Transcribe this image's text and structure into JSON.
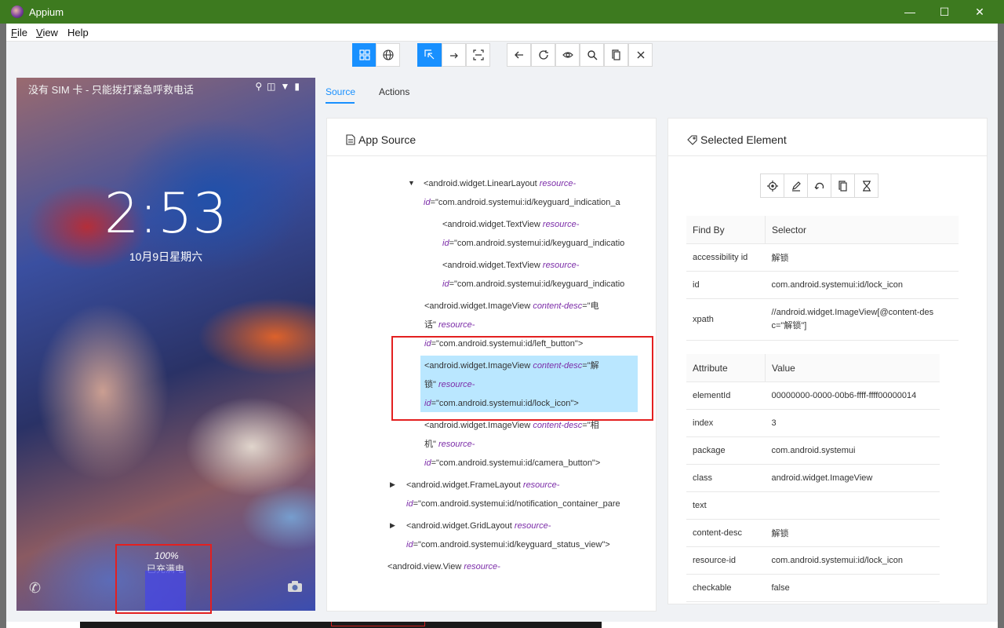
{
  "window": {
    "title": "Appium",
    "controls": [
      "—",
      "☐",
      "✕"
    ]
  },
  "menu": [
    {
      "label_u": "F",
      "label_rest": "ile"
    },
    {
      "label_u": "V",
      "label_rest": "iew"
    },
    {
      "label_u": "",
      "label_rest": "Help"
    }
  ],
  "device": {
    "status_text": "没有 SIM 卡 - 只能拨打紧急呼救电话",
    "clock": "2:53",
    "date": "10月9日星期六",
    "battery_percent": "100%",
    "charge_text": "已充满电"
  },
  "tabs": {
    "source": "Source",
    "actions": "Actions"
  },
  "app_source": {
    "title": "App Source",
    "nodes": [
      {
        "tag": "<android.widget.LinearLayout ",
        "attr": "resource-",
        "line2_attr": "id",
        "line2_val": "=\"com.android.systemui:id/keyguard_indication_a"
      },
      {
        "tag": "<android.widget.TextView ",
        "attr": "resource-",
        "line2_attr": "id",
        "line2_val": "=\"com.android.systemui:id/keyguard_indicatio"
      },
      {
        "tag": "<android.widget.TextView ",
        "attr": "resource-",
        "line2_attr": "id",
        "line2_val": "=\"com.android.systemui:id/keyguard_indicatio"
      },
      {
        "tag": "<android.widget.ImageView ",
        "attr": "content-desc",
        "val": "=\"电",
        "line2_val": "话\" ",
        "line2_attr": "resource-",
        "line3_attr": "id",
        "line3_val": "=\"com.android.systemui:id/left_button\">"
      },
      {
        "tag": "<android.widget.ImageView ",
        "attr": "content-desc",
        "val": "=\"解",
        "line2_val": "锁\" ",
        "line2_attr": "resource-",
        "line3_attr": "id",
        "line3_val": "=\"com.android.systemui:id/lock_icon\">"
      },
      {
        "tag": "<android.widget.ImageView ",
        "attr": "content-desc",
        "val": "=\"相",
        "line2_val": "机\" ",
        "line2_attr": "resource-",
        "line3_attr": "id",
        "line3_val": "=\"com.android.systemui:id/camera_button\">"
      },
      {
        "tag": "<android.widget.FrameLayout ",
        "attr": "resource-",
        "line2_attr": "id",
        "line2_val": "=\"com.android.systemui:id/notification_container_pare"
      },
      {
        "tag": "<android.widget.GridLayout ",
        "attr": "resource-",
        "line2_attr": "id",
        "line2_val": "=\"com.android.systemui:id/keyguard_status_view\">"
      },
      {
        "tag": "<android.view.View ",
        "attr": "resource-"
      }
    ]
  },
  "selected": {
    "title": "Selected Element",
    "find_by_headers": [
      "Find By",
      "Selector"
    ],
    "find_by": [
      {
        "key": "accessibility id",
        "value": "解锁"
      },
      {
        "key": "id",
        "value": "com.android.systemui:id/lock_icon"
      },
      {
        "key": "xpath",
        "value": "//android.widget.ImageView[@content-des",
        "value2": "c=\"解锁\"]"
      }
    ],
    "attr_headers": [
      "Attribute",
      "Value"
    ],
    "attributes": [
      {
        "key": "elementId",
        "value": "00000000-0000-00b6-ffff-ffff00000014"
      },
      {
        "key": "index",
        "value": "3"
      },
      {
        "key": "package",
        "value": "com.android.systemui"
      },
      {
        "key": "class",
        "value": "android.widget.ImageView"
      },
      {
        "key": "text",
        "value": ""
      },
      {
        "key": "content-desc",
        "value": "解锁"
      },
      {
        "key": "resource-id",
        "value": "com.android.systemui:id/lock_icon"
      },
      {
        "key": "checkable",
        "value": "false"
      }
    ]
  },
  "colors": {
    "accent": "#1890ff",
    "titlebar": "#3d7a1f",
    "highlight": "#bae7ff",
    "red_box": "#e32020"
  }
}
